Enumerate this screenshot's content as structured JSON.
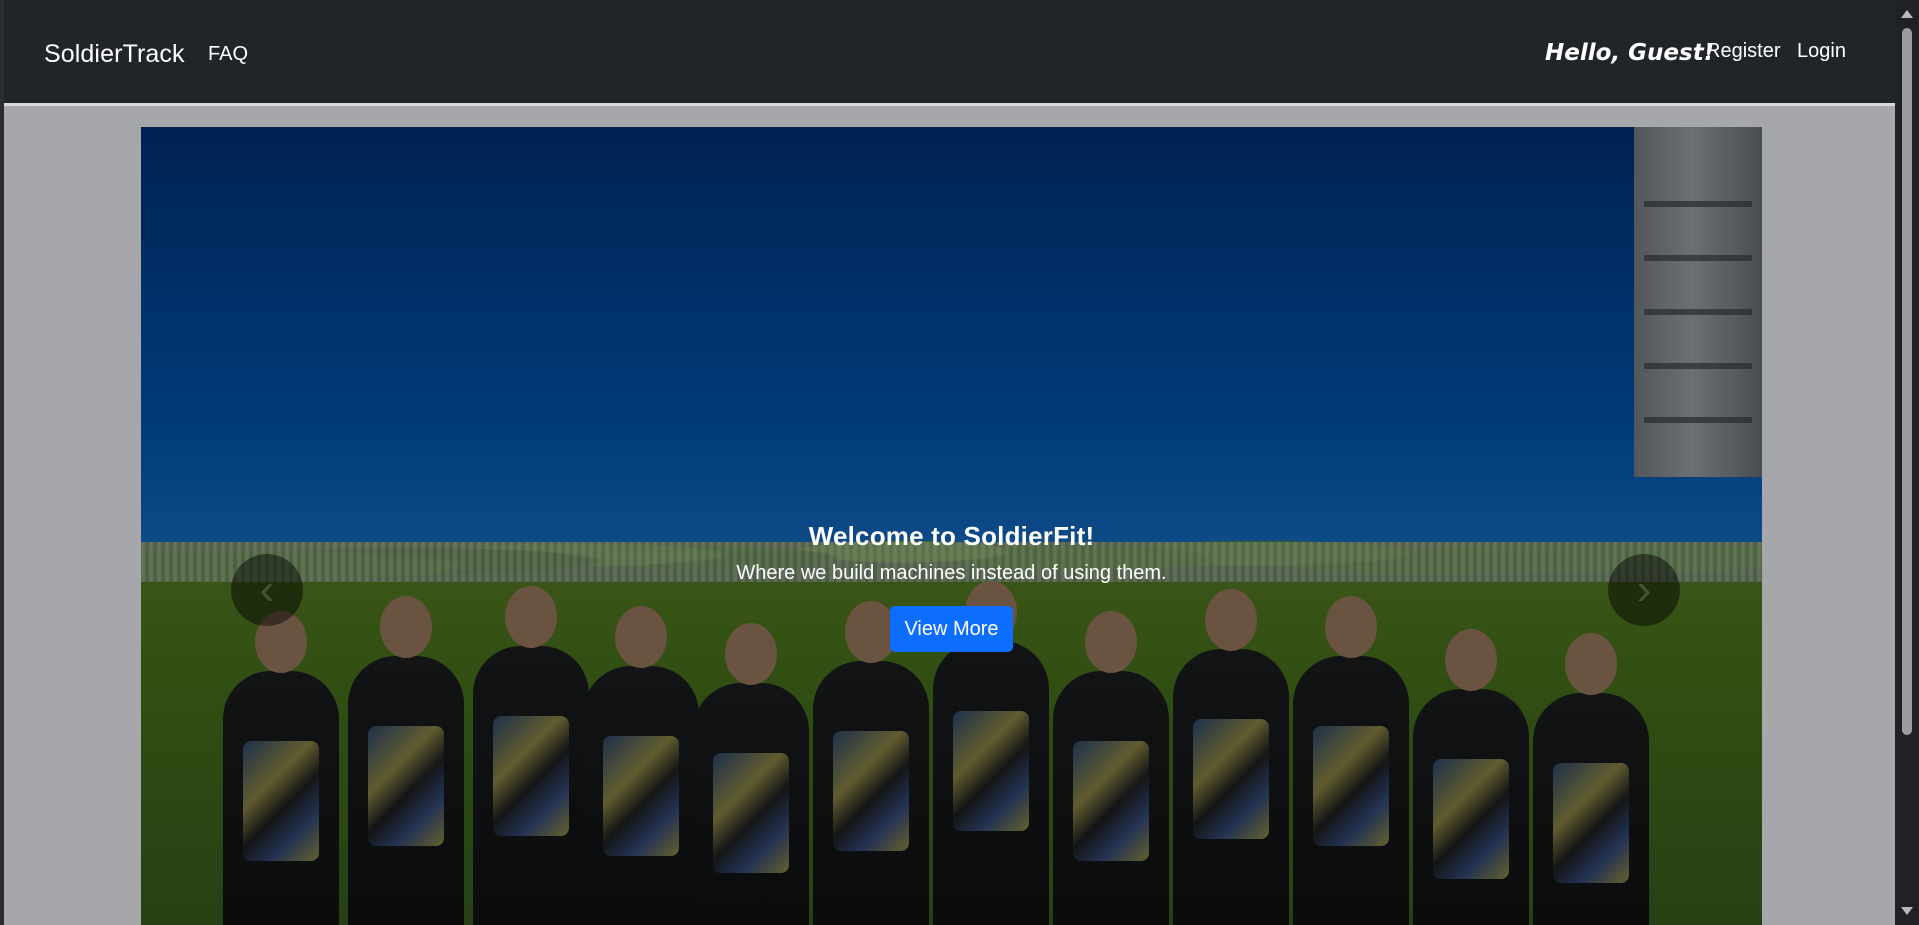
{
  "navbar": {
    "brand": "SoldierTrack",
    "links": {
      "faq": "FAQ",
      "register": "Register",
      "login": "Login"
    },
    "greeting": "Hello, Guest!"
  },
  "hero": {
    "title": "Welcome to SoldierFit!",
    "subtitle": "Where we build machines instead of using them.",
    "button_label": "View More",
    "previous_icon": "chevron-left-icon",
    "next_icon": "chevron-right-icon"
  },
  "colors": {
    "navbar": "#212529",
    "primary_button": "#0d6efd",
    "page_background": "#a6a7ab"
  }
}
